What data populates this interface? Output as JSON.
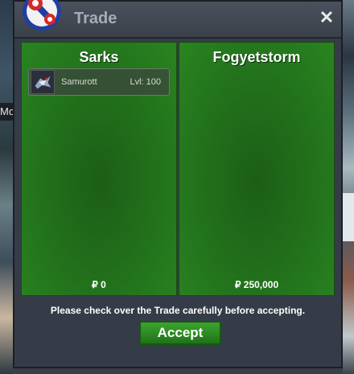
{
  "background": {
    "left_text": "Mo"
  },
  "window": {
    "title": "Trade",
    "close_glyph": "✕",
    "logo_icon": "pokeball-logo-icon"
  },
  "panels": [
    {
      "name": "Sarks",
      "items": [
        {
          "pokemon": "Samurott",
          "level": "Lvl: 100",
          "icon": "samurott-icon"
        }
      ],
      "money": "₽ 0"
    },
    {
      "name": "Fogyetstorm",
      "items": [],
      "money": "₽ 250,000"
    }
  ],
  "notice": "Please check over the Trade carefully before accepting.",
  "accept_label": "Accept",
  "colors": {
    "panel_green": "#23741c",
    "accept_green": "#2b8a22",
    "window_bg": "#363c47",
    "logo_red": "#d42a2a",
    "logo_blue": "#1f3fa0"
  }
}
